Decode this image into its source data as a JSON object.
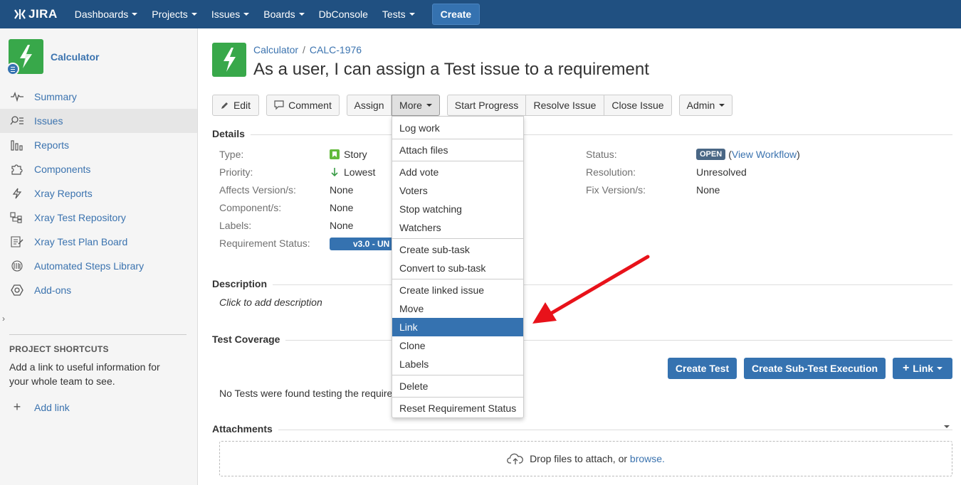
{
  "nav": {
    "logo": "JIRA",
    "items": [
      {
        "label": "Dashboards",
        "caret": true
      },
      {
        "label": "Projects",
        "caret": true
      },
      {
        "label": "Issues",
        "caret": true
      },
      {
        "label": "Boards",
        "caret": true
      },
      {
        "label": "DbConsole",
        "caret": false
      },
      {
        "label": "Tests",
        "caret": true
      }
    ],
    "create_label": "Create"
  },
  "sidebar": {
    "project_name": "Calculator",
    "items": [
      {
        "label": "Summary",
        "icon": "pulse-icon"
      },
      {
        "label": "Issues",
        "icon": "issues-search-icon"
      },
      {
        "label": "Reports",
        "icon": "reports-icon"
      },
      {
        "label": "Components",
        "icon": "puzzle-icon"
      },
      {
        "label": "Xray Reports",
        "icon": "bolt-icon"
      },
      {
        "label": "Xray Test Repository",
        "icon": "repository-icon"
      },
      {
        "label": "Xray Test Plan Board",
        "icon": "plan-board-icon"
      },
      {
        "label": "Automated Steps Library",
        "icon": "library-icon"
      },
      {
        "label": "Add-ons",
        "icon": "hexagon-icon"
      }
    ],
    "shortcuts_title": "PROJECT SHORTCUTS",
    "shortcuts_desc": "Add a link to useful information for your whole team to see.",
    "add_link": "Add link"
  },
  "issue": {
    "breadcrumb_project": "Calculator",
    "breadcrumb_sep": "/",
    "key": "CALC-1976",
    "title": "As a user, I can assign a Test issue to a requirement"
  },
  "toolbar": {
    "edit": "Edit",
    "comment": "Comment",
    "assign": "Assign",
    "more": "More",
    "start_progress": "Start Progress",
    "resolve": "Resolve Issue",
    "close": "Close Issue",
    "admin": "Admin"
  },
  "details": {
    "title": "Details",
    "left": [
      {
        "label": "Type:",
        "value": "Story"
      },
      {
        "label": "Priority:",
        "value": "Lowest"
      },
      {
        "label": "Affects Version/s:",
        "value": "None"
      },
      {
        "label": "Component/s:",
        "value": "None"
      },
      {
        "label": "Labels:",
        "value": "None"
      },
      {
        "label": "Requirement Status:",
        "value": "v3.0 - UN"
      }
    ],
    "right": [
      {
        "label": "Status:",
        "value": "OPEN",
        "extra": "View Workflow"
      },
      {
        "label": "Resolution:",
        "value": "Unresolved"
      },
      {
        "label": "Fix Version/s:",
        "value": "None"
      }
    ]
  },
  "description": {
    "title": "Description",
    "placeholder": "Click to add description"
  },
  "coverage": {
    "title": "Test Coverage",
    "create_test": "Create Test",
    "create_sub": "Create Sub-Test Execution",
    "link": "Link",
    "empty": "No Tests were found testing the require"
  },
  "attachments": {
    "title": "Attachments",
    "drop_text": "Drop files to attach, or",
    "browse": "browse."
  },
  "more_menu": {
    "groups": [
      [
        "Log work"
      ],
      [
        "Attach files"
      ],
      [
        "Add vote",
        "Voters",
        "Stop watching",
        "Watchers"
      ],
      [
        "Create sub-task",
        "Convert to sub-task"
      ],
      [
        "Create linked issue",
        "Move",
        "Link",
        "Clone",
        "Labels"
      ],
      [
        "Delete"
      ],
      [
        "Reset Requirement Status"
      ]
    ],
    "highlighted": "Link"
  },
  "colors": {
    "header": "#205081",
    "primary": "#3572b0",
    "link": "#3b73af",
    "annotation_arrow": "#e8121a"
  }
}
